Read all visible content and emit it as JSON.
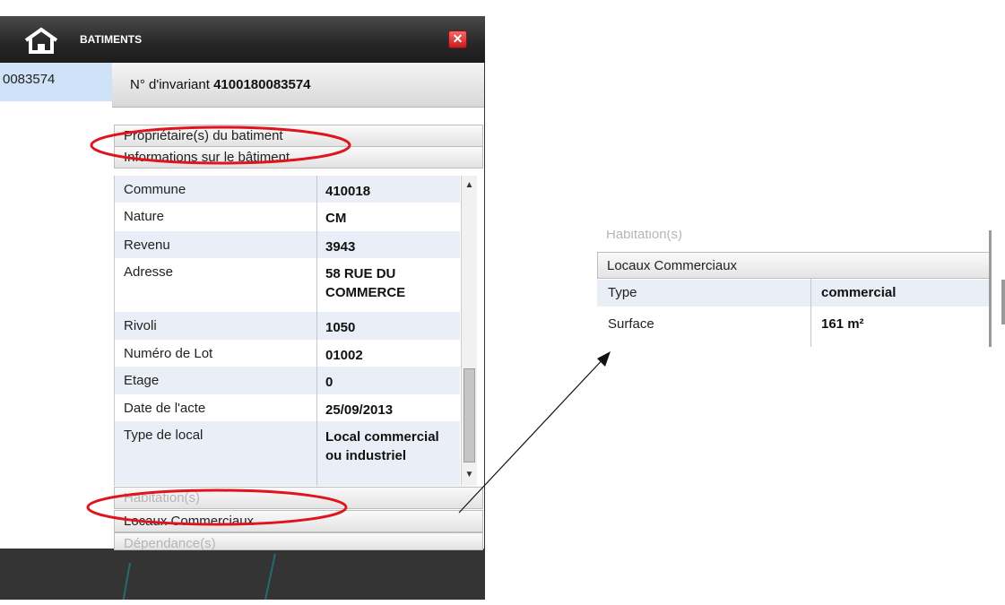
{
  "window": {
    "title": "BATIMENTS",
    "close_icon": "close-icon",
    "home_icon": "home-icon"
  },
  "list": {
    "selected_id": "0083574"
  },
  "detail": {
    "invariant_label": "N° d'invariant",
    "invariant_value": "4100180083574",
    "accordions": {
      "owners": "Propriétaire(s) du batiment",
      "info": "Informations sur le bâtiment",
      "habitation": "Habitation(s)",
      "commercial": "Locaux Commerciaux",
      "dependance": "Dépendance(s)"
    },
    "info_rows": [
      {
        "label": "Commune",
        "value": "410018"
      },
      {
        "label": "Nature",
        "value": "CM"
      },
      {
        "label": "Revenu",
        "value": "3943"
      },
      {
        "label": "Adresse",
        "value": "58  RUE DU COMMERCE"
      },
      {
        "label": "Rivoli",
        "value": "1050"
      },
      {
        "label": "Numéro de Lot",
        "value": "01002"
      },
      {
        "label": "Etage",
        "value": "0"
      },
      {
        "label": "Date de l'acte",
        "value": "25/09/2013"
      },
      {
        "label": "Type de local",
        "value": "Local commercial ou industriel"
      }
    ]
  },
  "inset": {
    "cut_label": "Habitation(s)",
    "header": "Locaux Commerciaux",
    "rows": [
      {
        "label": "Type",
        "value": "commercial"
      },
      {
        "label": "Surface",
        "value": "161 m²"
      }
    ]
  },
  "colors": {
    "annotation": "#e0141d",
    "window_dark": "#343434",
    "selected_item": "#cfe2f7",
    "row_alt": "#e9eef7",
    "close_red": "#d42b2b"
  }
}
